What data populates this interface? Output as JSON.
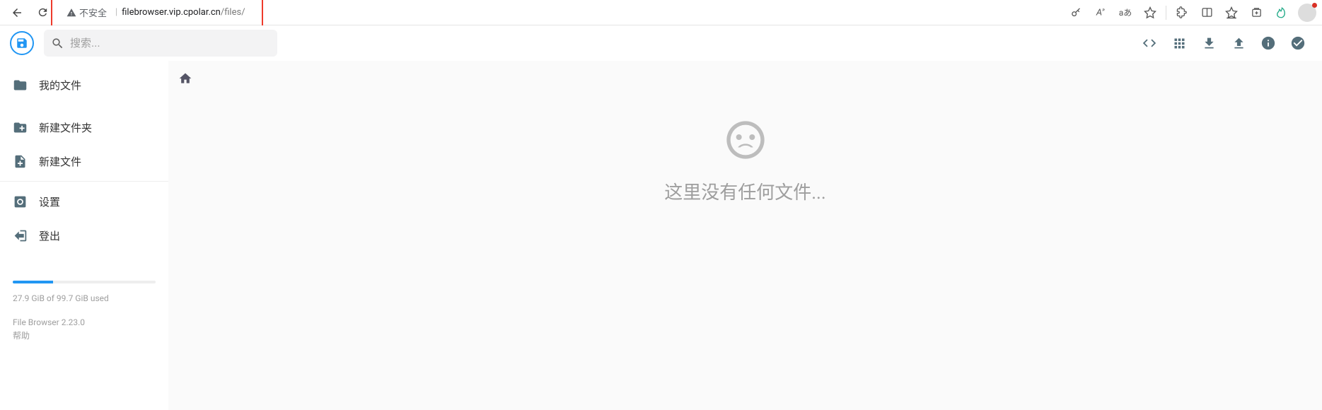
{
  "browser": {
    "security_label": "不安全",
    "url_host": "filebrowser.vip.cpolar.cn",
    "url_path": "/files/"
  },
  "search": {
    "placeholder": "搜索..."
  },
  "sidebar": {
    "items": [
      {
        "label": "我的文件"
      },
      {
        "label": "新建文件夹"
      },
      {
        "label": "新建文件"
      },
      {
        "label": "设置"
      },
      {
        "label": "登出"
      }
    ],
    "storage_pct": 28,
    "storage_text": "27.9 GiB of 99.7 GiB used",
    "version": "File Browser 2.23.0",
    "help": "帮助"
  },
  "main": {
    "empty_text": "这里没有任何文件..."
  }
}
